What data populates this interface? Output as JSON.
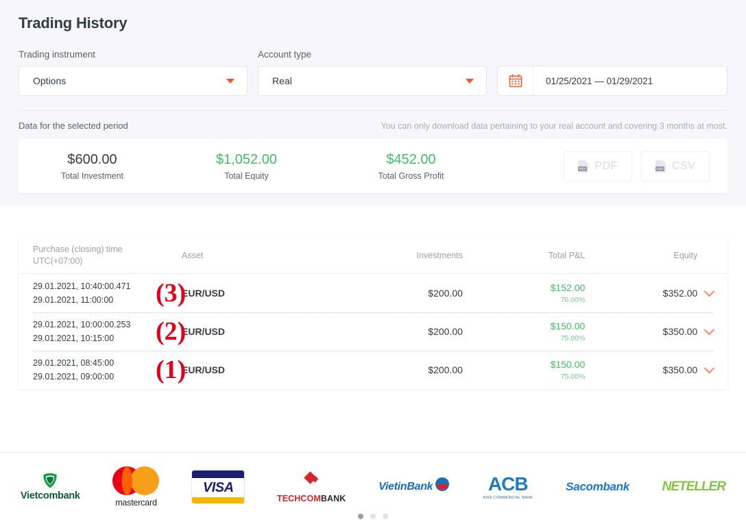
{
  "page": {
    "title": "Trading History"
  },
  "filters": {
    "instrument": {
      "label": "Trading instrument",
      "value": "Options",
      "icon": "chevron-down-icon"
    },
    "account": {
      "label": "Account type",
      "value": "Real",
      "icon": "chevron-down-icon"
    },
    "date_range": {
      "value": "01/25/2021 — 01/29/2021",
      "icon": "calendar-icon"
    }
  },
  "period": {
    "label": "Data for the selected period",
    "note": "You can only download data pertaining to your real account and covering 3 months at most."
  },
  "stats": [
    {
      "value": "$600.00",
      "caption": "Total Investment",
      "color": "#333b46"
    },
    {
      "value": "$1,052.00",
      "caption": "Total Equity",
      "color": "#3fbf62"
    },
    {
      "value": "$452.00",
      "caption": "Total Gross Profit",
      "color": "#3fbf62"
    }
  ],
  "downloads": [
    {
      "label": "PDF",
      "icon": "pdf-file-icon",
      "tag": "PDF"
    },
    {
      "label": "CSV",
      "icon": "csv-file-icon",
      "tag": "CSV"
    }
  ],
  "table": {
    "headers": {
      "time_line1": "Purchase (closing) time",
      "time_line2": "UTC(+07:00)",
      "asset": "Asset",
      "investments": "Investments",
      "pl": "Total P&L",
      "equity": "Equity"
    },
    "rows": [
      {
        "marker": "(3)",
        "time_open": "29.01.2021, 10:40:00.471",
        "time_close": "29.01.2021, 11:00:00",
        "asset": "EUR/USD",
        "investments": "$200.00",
        "pl_amount": "$152.00",
        "pl_percent": "76.00%",
        "equity": "$352.00",
        "expand_icon": "chevron-down-icon"
      },
      {
        "marker": "(2)",
        "time_open": "29.01.2021, 10:00:00.253",
        "time_close": "29.01.2021, 10:15:00",
        "asset": "EUR/USD",
        "investments": "$200.00",
        "pl_amount": "$150.00",
        "pl_percent": "75.00%",
        "equity": "$350.00",
        "expand_icon": "chevron-down-icon"
      },
      {
        "marker": "(1)",
        "time_open": "29.01.2021, 08:45:00",
        "time_close": "29.01.2021, 09:00:00",
        "asset": "EUR/USD",
        "investments": "$200.00",
        "pl_amount": "$150.00",
        "pl_percent": "75.00%",
        "equity": "$350.00",
        "expand_icon": "chevron-down-icon"
      }
    ]
  },
  "footer": {
    "logos": [
      {
        "name": "Vietcombank"
      },
      {
        "name": "mastercard"
      },
      {
        "name": "VISA"
      },
      {
        "name_red": "TECHCOM",
        "name_dark": "BANK"
      },
      {
        "name": "VietinBank"
      },
      {
        "name": "ACB",
        "sub": "ASIA COMMERCIAL BANK"
      },
      {
        "name": "Sacombank"
      },
      {
        "name": "NETELLER"
      }
    ],
    "carousel_dots": 3,
    "carousel_active": 0
  },
  "colors": {
    "accent": "#ec5c2b",
    "positive": "#3fbf62",
    "marker": "#e2001a",
    "text": "#333b46",
    "muted": "#9ba0ab",
    "top_bg": "#f7f7fb"
  }
}
